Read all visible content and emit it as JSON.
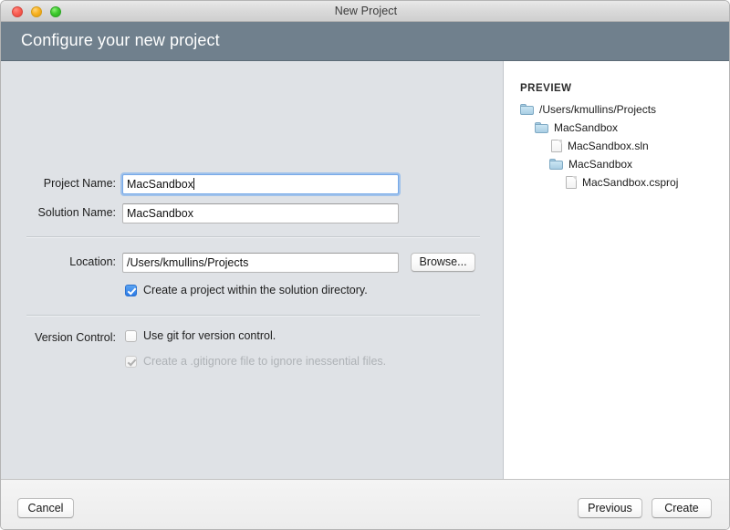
{
  "window": {
    "title": "New Project",
    "traffic_lights": [
      "close",
      "minimize",
      "maximize"
    ]
  },
  "banner": {
    "title": "Configure your new project"
  },
  "form": {
    "project_name": {
      "label": "Project Name:",
      "value": "MacSandbox",
      "focused": true
    },
    "solution_name": {
      "label": "Solution Name:",
      "value": "MacSandbox",
      "focused": false
    },
    "location": {
      "label": "Location:",
      "value": "/Users/kmullins/Projects",
      "browse_label": "Browse..."
    },
    "create_project_dir": {
      "label": "Create a project within the solution directory.",
      "checked": true,
      "enabled": true
    },
    "version_control": {
      "label": "Version Control:",
      "use_git": {
        "label": "Use git for version control.",
        "checked": false,
        "enabled": true
      },
      "gitignore": {
        "label": "Create a .gitignore file to ignore inessential files.",
        "checked": true,
        "enabled": false
      }
    }
  },
  "preview": {
    "heading": "PREVIEW",
    "tree": [
      {
        "name": "/Users/kmullins/Projects",
        "type": "folder",
        "depth": 0
      },
      {
        "name": "MacSandbox",
        "type": "folder",
        "depth": 1
      },
      {
        "name": "MacSandbox.sln",
        "type": "file",
        "depth": 2
      },
      {
        "name": "MacSandbox",
        "type": "folder",
        "depth": 2
      },
      {
        "name": "MacSandbox.csproj",
        "type": "file",
        "depth": 3
      }
    ]
  },
  "footer": {
    "cancel_label": "Cancel",
    "previous_label": "Previous",
    "create_label": "Create"
  },
  "colors": {
    "banner_bg": "#70808d",
    "left_pane_bg": "#dfe2e6",
    "accent_checkbox": "#2b7ae6",
    "focus_ring": "#76a9e8"
  }
}
